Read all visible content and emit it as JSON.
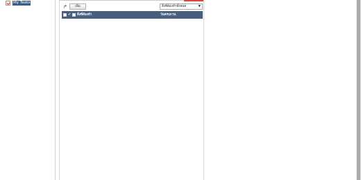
{
  "sidebar": {
    "items": [
      {
        "label": "My Tasks",
        "icon": "task-list-icon",
        "selected": true
      }
    ]
  },
  "toolbar": {
    "redo_icon": "redo-arrow-icon",
    "add_label": "เพิ่ม",
    "filter": {
      "selected": "สิ่งที่ต้องทำทั้งหมด",
      "arrow": "▼"
    }
  },
  "table": {
    "tick_glyph": "✔",
    "columns": [
      "สิ่งที่ต้องทำ",
      "วันครบกาน"
    ],
    "rows": []
  },
  "colors": {
    "header_bg": "#485f7d",
    "selected_nav_bg": "#3a5b8c",
    "accent_red": "#d8463d",
    "scrollbar_thumb": "#aaaaaa"
  }
}
